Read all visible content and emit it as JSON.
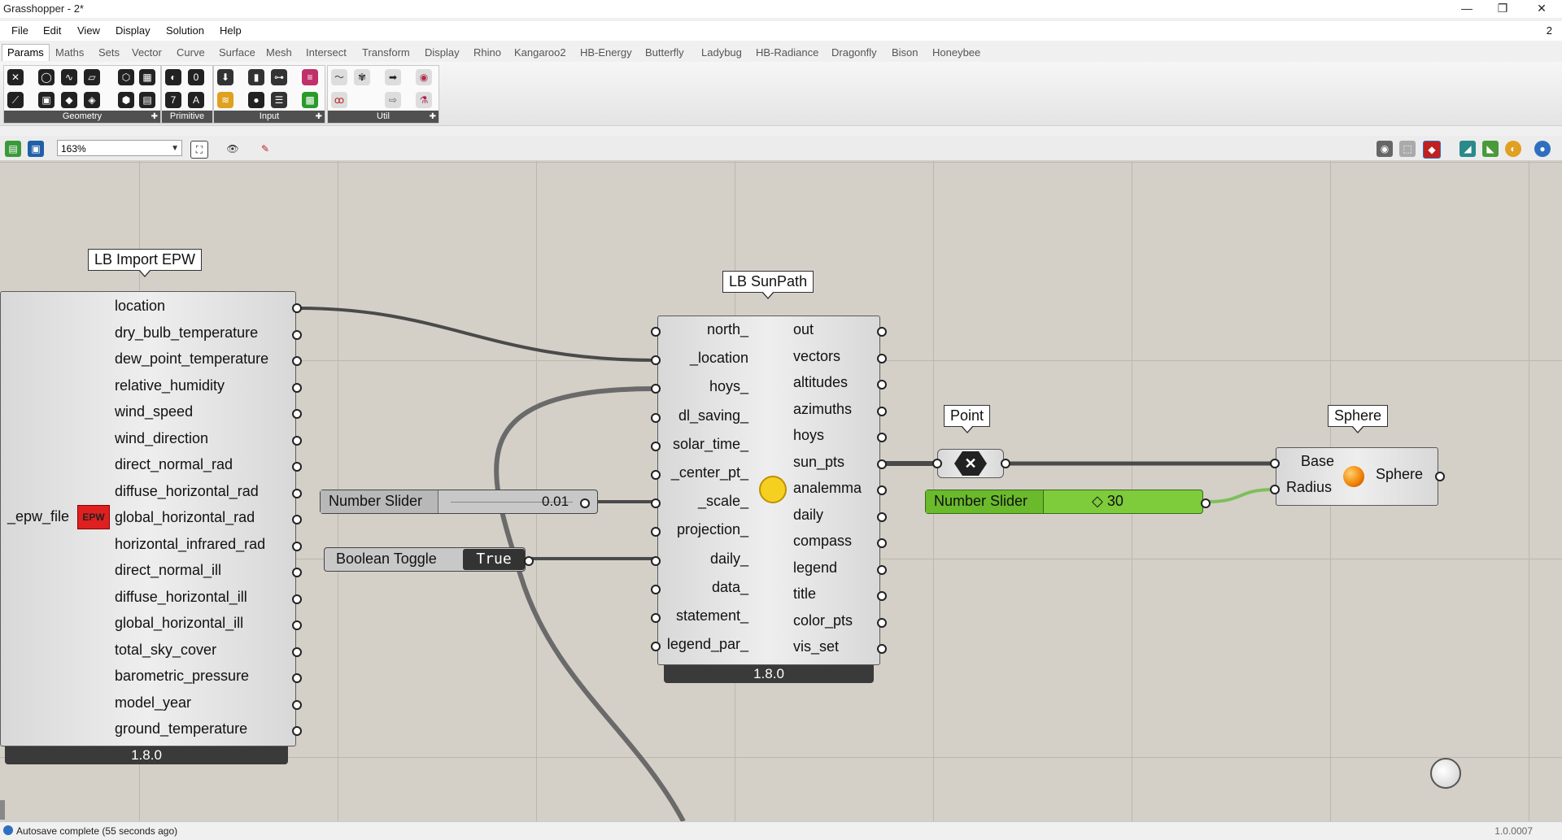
{
  "window": {
    "title": "Grasshopper - 2*",
    "controls": {
      "minimize": "—",
      "maximize": "❐",
      "close": "✕"
    }
  },
  "menu": {
    "items": [
      "File",
      "Edit",
      "View",
      "Display",
      "Solution",
      "Help"
    ],
    "right_indicator": "2"
  },
  "tabs": [
    "Params",
    "Maths",
    "Sets",
    "Vector",
    "Curve",
    "Surface",
    "Mesh",
    "Intersect",
    "Transform",
    "Display",
    "Rhino",
    "Kangaroo2",
    "HB-Energy",
    "Butterfly",
    "Ladybug",
    "HB-Radiance",
    "Dragonfly",
    "Bison",
    "Honeybee"
  ],
  "active_tab": "Params",
  "ribbon_groups": [
    "Geometry",
    "Primitive",
    "Input",
    "Util"
  ],
  "toolbar": {
    "zoom": "163%"
  },
  "canvas": {
    "import_epw": {
      "title": "LB Import EPW",
      "input": "_epw_file",
      "input_icon": "EPW",
      "outputs": [
        "location",
        "dry_bulb_temperature",
        "dew_point_temperature",
        "relative_humidity",
        "wind_speed",
        "wind_direction",
        "direct_normal_rad",
        "diffuse_horizontal_rad",
        "global_horizontal_rad",
        "horizontal_infrared_rad",
        "direct_normal_ill",
        "diffuse_horizontal_ill",
        "global_horizontal_ill",
        "total_sky_cover",
        "barometric_pressure",
        "model_year",
        "ground_temperature"
      ],
      "version": "1.8.0"
    },
    "sunpath": {
      "title": "LB SunPath",
      "inputs": [
        "north_",
        "_location",
        "hoys_",
        "dl_saving_",
        "solar_time_",
        "_center_pt_",
        "_scale_",
        "projection_",
        "daily_",
        "data_",
        "statement_",
        "legend_par_"
      ],
      "outputs": [
        "out",
        "vectors",
        "altitudes",
        "azimuths",
        "hoys",
        "sun_pts",
        "analemma",
        "daily",
        "compass",
        "legend",
        "title",
        "color_pts",
        "vis_set"
      ],
      "version": "1.8.0"
    },
    "slider_scale": {
      "label": "Number Slider",
      "value": "0.01"
    },
    "boolean_toggle": {
      "label": "Boolean Toggle",
      "value": "True"
    },
    "point": {
      "title": "Point"
    },
    "slider_radius": {
      "label": "Number Slider",
      "value": "◇ 30"
    },
    "sphere": {
      "title": "Sphere",
      "inputs": [
        "Base",
        "Radius"
      ],
      "output": "Sphere"
    }
  },
  "status": {
    "message": "Autosave complete (55 seconds ago)",
    "version": "1.0.0007"
  },
  "colors": {
    "canvas": "#d4d0c8",
    "slider_green": "#7ecb3c",
    "wire": "#4a4a4a"
  }
}
